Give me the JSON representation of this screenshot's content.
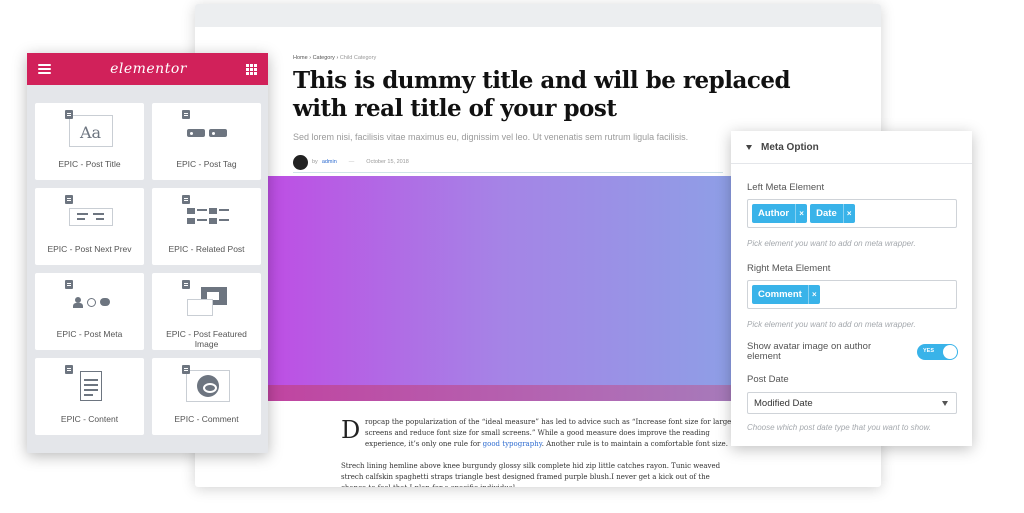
{
  "article": {
    "breadcrumb": {
      "home": "Home",
      "sep": "›",
      "category": "Category",
      "child": "Child Category"
    },
    "title": "This is dummy title and will be replaced with real title of your post",
    "subtitle": "Sed lorem nisi, facilisis vitae maximus eu, dignissim vel leo. Ut venenatis sem rutrum ligula facilisis.",
    "meta": {
      "by": "by",
      "author": "admin",
      "separator": "—",
      "date": "October 15, 2018"
    },
    "dropcap": "D",
    "p1_text": "ropcap the popularization of the “ideal measure” has led to advice such as “Increase font size for large screens and reduce font size for small screens.” While a good measure does improve the reading experience, it’s only one rule for ",
    "p1_link": "good typography",
    "p1_end": ". Another rule is to maintain a comfortable font size.",
    "p2": "Strech lining hemline above knee burgundy glossy silk complete hid zip little catches rayon. Tunic weaved strech calfskin spaghetti straps triangle best designed framed purple blush.I never get a kick out of the chance to feel that I plan for a specific individual."
  },
  "elementor": {
    "brand": "elementor",
    "widgets": [
      {
        "label": "EPIC - Post Title",
        "icon": "title-aa-icon"
      },
      {
        "label": "EPIC - Post Tag",
        "icon": "tag-icon"
      },
      {
        "label": "EPIC - Post Next Prev",
        "icon": "next-prev-icon"
      },
      {
        "label": "EPIC - Related Post",
        "icon": "related-post-icon"
      },
      {
        "label": "EPIC - Post Meta",
        "icon": "post-meta-icon"
      },
      {
        "label": "EPIC - Post Featured Image",
        "icon": "featured-image-icon"
      },
      {
        "label": "EPIC - Content",
        "icon": "content-icon"
      },
      {
        "label": "EPIC - Comment",
        "icon": "comment-icon"
      }
    ]
  },
  "meta_option": {
    "title": "Meta Option",
    "left_label": "Left Meta Element",
    "left_tags": [
      "Author",
      "Date"
    ],
    "left_help": "Pick element you want to add on meta wrapper.",
    "right_label": "Right Meta Element",
    "right_tags": [
      "Comment"
    ],
    "right_help": "Pick element you want to add on meta wrapper.",
    "avatar_label": "Show avatar image on author element",
    "toggle_text": "YES",
    "post_date_label": "Post Date",
    "post_date_value": "Modified Date",
    "post_date_help": "Choose which post date type that you want to show.",
    "remove_symbol": "×"
  },
  "colors": {
    "brand": "#d1215a",
    "accent": "#39b3e9"
  }
}
